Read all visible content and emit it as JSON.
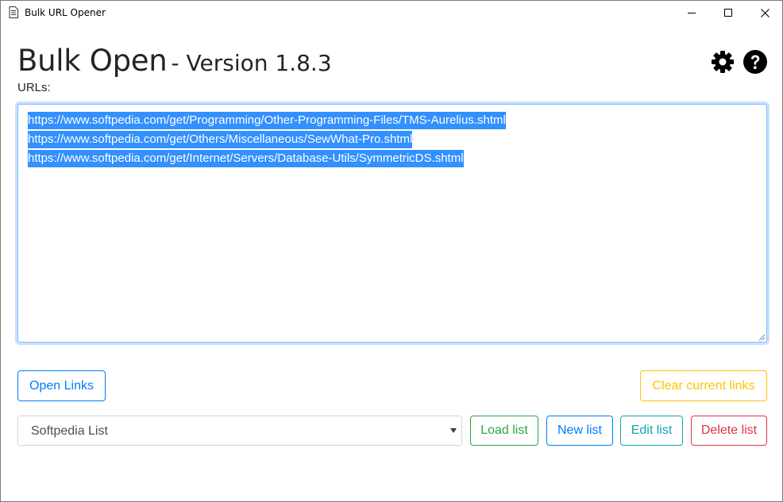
{
  "window": {
    "title": "Bulk URL Opener",
    "icon": "document-icon",
    "controls": [
      "minimize-icon",
      "maximize-icon",
      "close-icon"
    ]
  },
  "header": {
    "title": "Bulk Open",
    "version": "- Version 1.8.3",
    "settings_icon": "gear-icon",
    "help_icon": "question-circle-icon"
  },
  "urls": {
    "label": "URLs:",
    "lines": [
      "https://www.softpedia.com/get/Programming/Other-Programming-Files/TMS-Aurelius.shtml",
      "https://www.softpedia.com/get/Others/Miscellaneous/SewWhat-Pro.shtml",
      "https://www.softpedia.com/get/Internet/Servers/Database-Utils/SymmetricDS.shtml"
    ],
    "selection_color": "#3390ff"
  },
  "actions": {
    "open_links": "Open Links",
    "clear_links": "Clear current links"
  },
  "lists": {
    "selected": "Softpedia List",
    "load": "Load list",
    "new": "New list",
    "edit": "Edit list",
    "delete": "Delete list"
  },
  "colors": {
    "primary": "#007bff",
    "warning": "#ffc107",
    "success": "#28a745",
    "info": "#17a2b8",
    "danger": "#dc3545"
  }
}
